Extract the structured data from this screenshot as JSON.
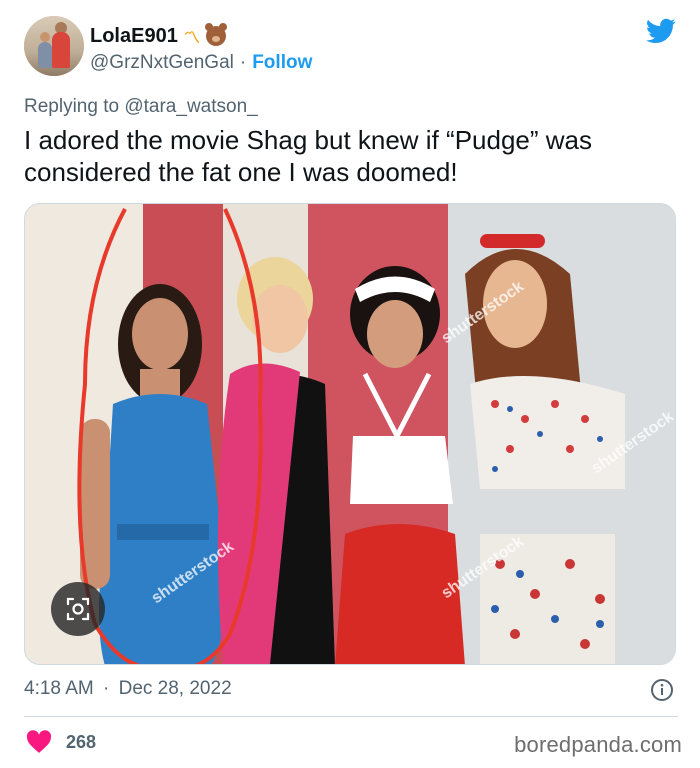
{
  "author": {
    "display_name": "LolaE901",
    "handle": "@GrzNxtGenGal",
    "follow_label": "Follow",
    "separator": "·",
    "emoji_m": "〽"
  },
  "reply": {
    "prefix": "Replying to",
    "mention": "@tara_watson_"
  },
  "tweet": {
    "text": "I adored the movie Shag but knew if “Pudge” was considered the fat one I was doomed!"
  },
  "photo": {
    "watermark": "shutterstock"
  },
  "meta": {
    "time": "4:18 AM",
    "separator": "·",
    "date": "Dec 28, 2022"
  },
  "engagement": {
    "likes": "268"
  },
  "brand": {
    "label": "boredpanda.com"
  },
  "colors": {
    "twitter_blue": "#1d9bf0",
    "like_pink": "#f91880",
    "circle_red": "#e8392b"
  },
  "icons": [
    "twitter-bird-icon",
    "lens-icon",
    "info-icon",
    "heart-icon"
  ]
}
